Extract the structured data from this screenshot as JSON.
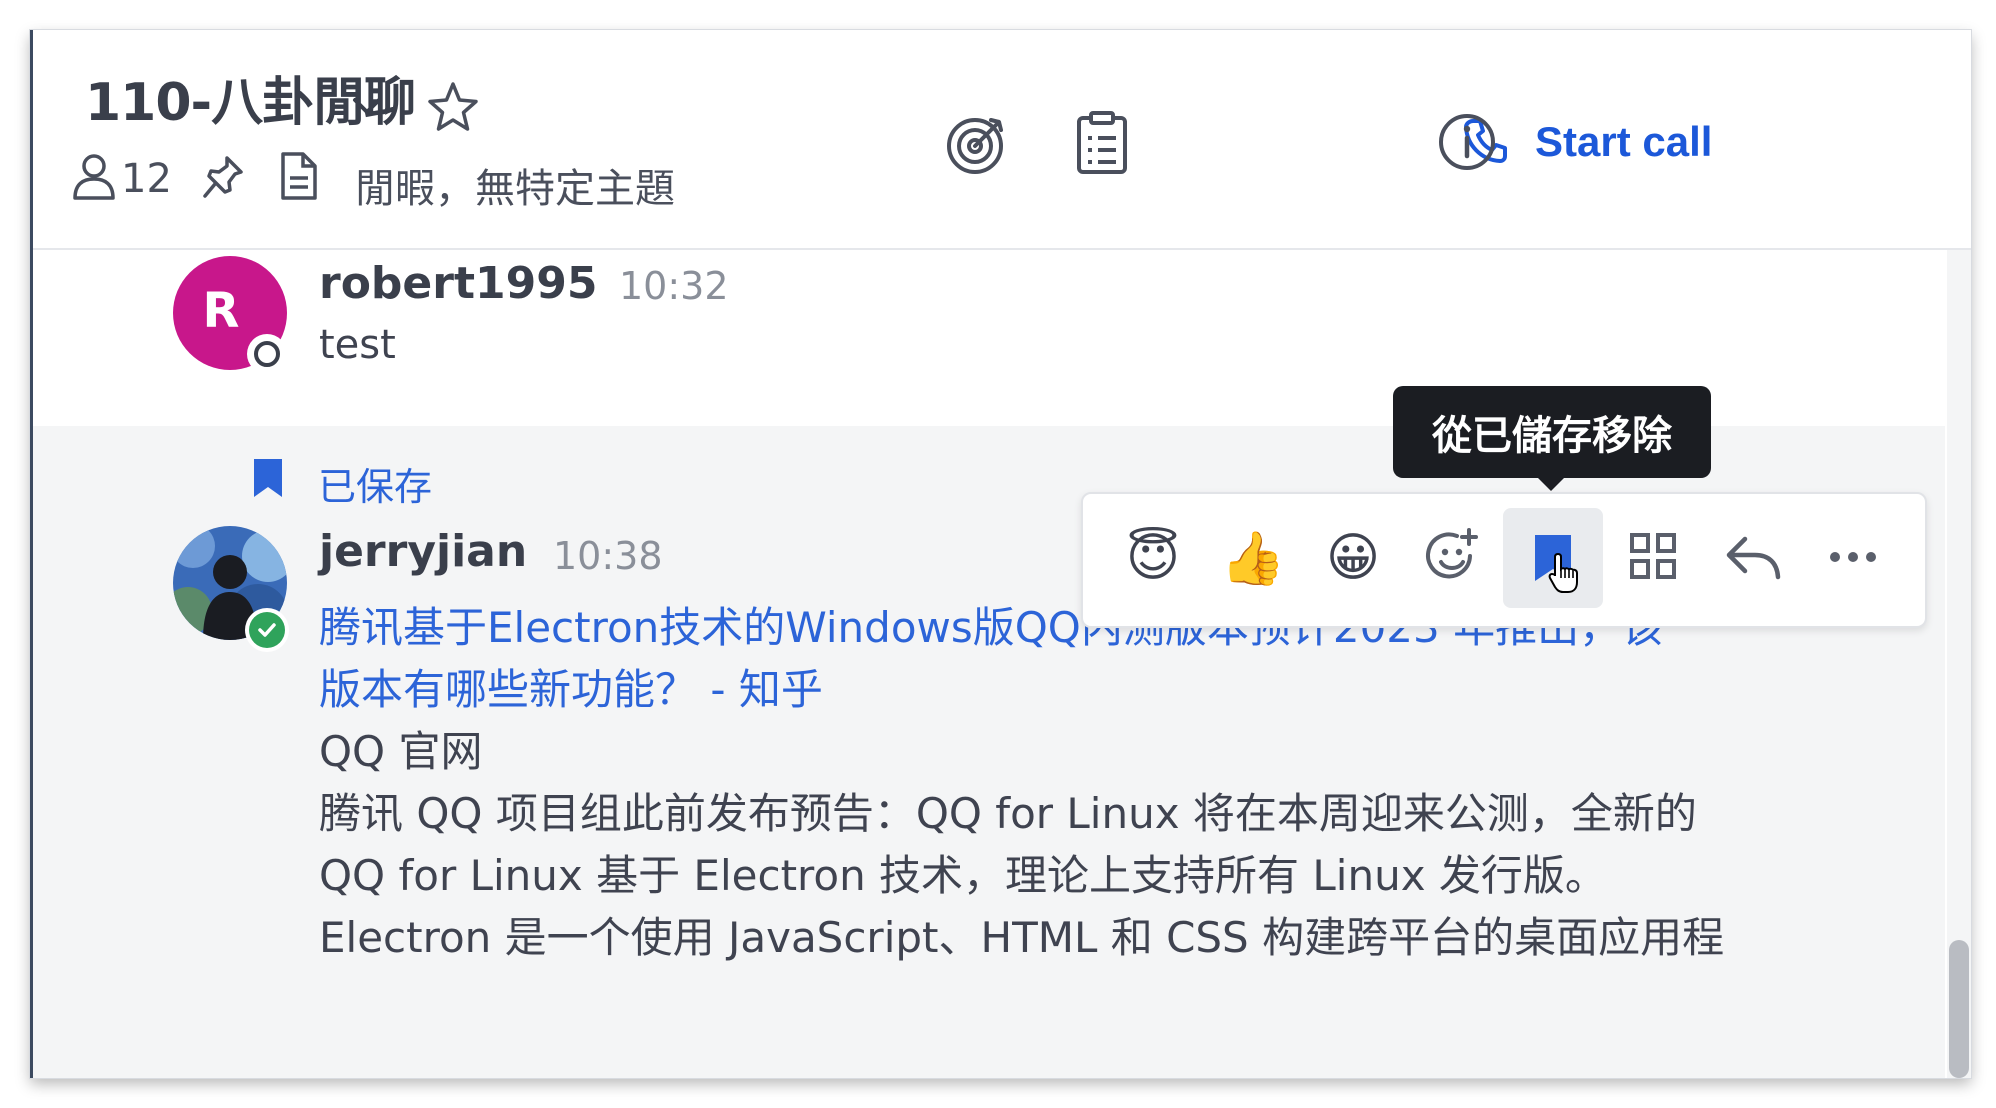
{
  "header": {
    "channel_name": "110-八卦閒聊",
    "member_count": "12",
    "purpose": "閒暇，無特定主題",
    "start_call_label": "Start call",
    "icons": [
      "chevron-down-icon",
      "star-icon",
      "member-icon",
      "pin-icon",
      "file-icon",
      "target-icon",
      "clipboard-icon",
      "phone-icon",
      "info-icon"
    ]
  },
  "messages": [
    {
      "avatar_letter": "R",
      "avatar_color": "#c8178b",
      "username": "robert1995",
      "time": "10:32",
      "text": "test",
      "status": "offline"
    },
    {
      "saved_label": "已保存",
      "username": "jerryjian",
      "time": "10:38",
      "status": "online",
      "link_lines": [
        " 腾讯基于Electron技术的Windows版QQ内测版本预计2023 年推出，该",
        "版本有哪些新功能？ - 知乎"
      ],
      "body_lines": [
        "QQ 官网",
        "腾讯 QQ 项目组此前发布预告：QQ for Linux 将在本周迎来公测，全新的",
        "QQ for Linux 基于 Electron 技术，理论上支持所有 Linux 发行版。",
        "Electron 是一个使用 JavaScript、HTML 和 CSS 构建跨平台的桌面应用程"
      ]
    }
  ],
  "hover_toolbar": {
    "tooltip": "從已儲存移除",
    "buttons": [
      "innocent-emoji",
      "thumbsup-emoji",
      "grinning-emoji",
      "add-reaction-icon",
      "saved-bookmark-icon",
      "apps-grid-icon",
      "reply-arrow-icon",
      "more-dots-icon"
    ],
    "emojis": [
      "😇",
      "👍",
      "😀"
    ]
  },
  "colors": {
    "accent": "#1c58d9",
    "link": "#2c64d8",
    "online": "#2fa35b",
    "saved_bg": "#f4f5f6"
  }
}
